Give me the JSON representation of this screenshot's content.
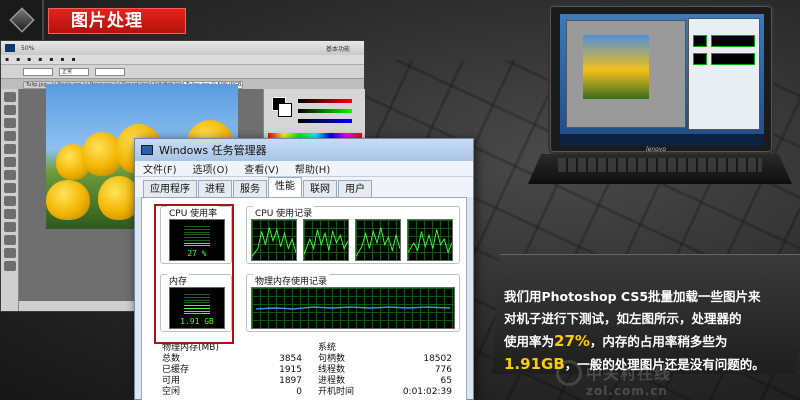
{
  "banner": {
    "title": "图片处理"
  },
  "photoshop": {
    "tabs": [
      "Tulip.jpg",
      "Koala.jpg",
      "Penguins.jpg",
      "Desert.jpg",
      "Jellyfish.jpg",
      "Tulips.jpg @ 50%(RGB/8)"
    ],
    "workspace": "基本功能",
    "mode": "正常",
    "status": "50%"
  },
  "laptop": {
    "brand": "lenovo"
  },
  "task_manager": {
    "title": "Windows 任务管理器",
    "menu": [
      "文件(F)",
      "选项(O)",
      "查看(V)",
      "帮助(H)"
    ],
    "tabs": [
      "应用程序",
      "进程",
      "服务",
      "性能",
      "联网",
      "用户"
    ],
    "active_tab": "性能",
    "cpu_usage_label": "CPU 使用率",
    "cpu_usage_value": "27 %",
    "cpu_usage_fraction": 0.27,
    "cpu_history_label": "CPU 使用记录",
    "memory_label": "内存",
    "memory_value": "1.91 GB",
    "memory_fraction": 0.5,
    "memory_history_label": "物理内存使用记录",
    "physical_memory": {
      "header": "物理内存(MB)",
      "rows": [
        {
          "label": "总数",
          "value": "3854"
        },
        {
          "label": "已缓存",
          "value": "1915"
        },
        {
          "label": "可用",
          "value": "1897"
        },
        {
          "label": "空闲",
          "value": "0"
        }
      ]
    },
    "system": {
      "header": "系统",
      "rows": [
        {
          "label": "句柄数",
          "value": "18502"
        },
        {
          "label": "线程数",
          "value": "776"
        },
        {
          "label": "进程数",
          "value": "65"
        },
        {
          "label": "开机时间",
          "value": "0:01:02:39"
        }
      ]
    }
  },
  "caption": {
    "line1": "我们用Photoshop CS5批量加载一些图片来",
    "line2": "对机子进行下测试，如左图所示，处理器的",
    "line3_pre": "使用率为",
    "line3_hl": "27%",
    "line3_post": "，内存的占用率稍多些为",
    "line4_hl": "1.91GB",
    "line4_post": "，一般的处理图片还是没有问题的。"
  },
  "watermark": {
    "name": "中关村在线",
    "site": "zol.com.cn"
  },
  "colors": {
    "banner_red": "#d91a14",
    "highlight": "#ffcc00",
    "meter_green": "#39ff39",
    "frame_red": "#a8141a"
  }
}
